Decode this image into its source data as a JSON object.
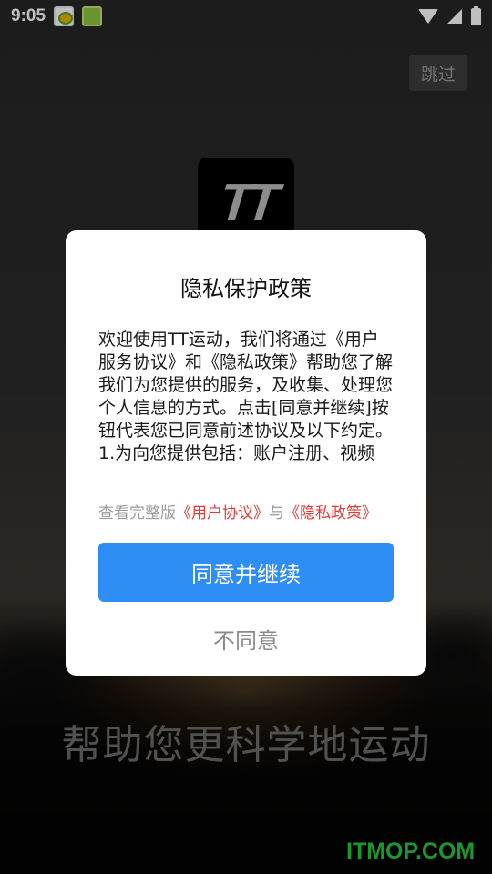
{
  "status_bar": {
    "time": "9:05",
    "notification_icons": [
      "app-notification-icon",
      "app-notification-icon"
    ],
    "right_icons": [
      "wifi-icon",
      "signal-icon",
      "battery-charging-icon"
    ]
  },
  "splash": {
    "skip_label": "跳过",
    "logo_text": "TT",
    "slogan": "帮助您更科学地运动"
  },
  "watermark": "ITMOP.COM",
  "dialog": {
    "title": "隐私保护政策",
    "body_paragraphs": [
      "欢迎使用TT运动，我们将通过《用户服务协议》和《隐私政策》帮助您了解我们为您提供的服务，及收集、处理您个人信息的方式。点击[同意并继续]按钮代表您已同意前述协议及以下约定。",
      "1.为向您提供包括：账户注册、视频"
    ],
    "agreement_prefix": "查看完整版",
    "user_agreement_link": "《用户协议》",
    "agreement_joiner": "与",
    "privacy_policy_link": "《隐私政策》",
    "agree_label": "同意并继续",
    "disagree_label": "不同意"
  },
  "colors": {
    "accent": "#2f8ef5",
    "link": "#e53935",
    "watermark": "#27c93f"
  }
}
